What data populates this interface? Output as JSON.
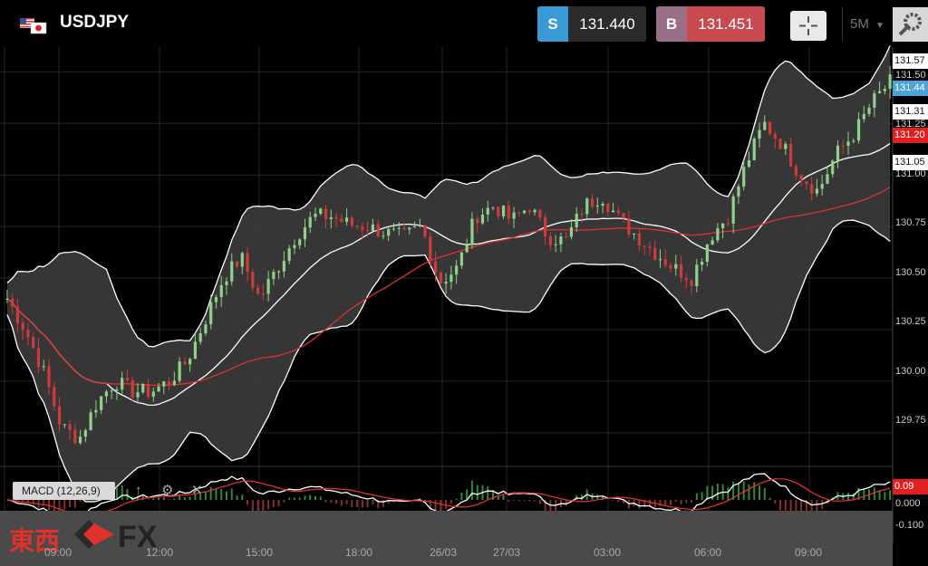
{
  "header": {
    "symbol": "USDJPY",
    "sell": {
      "label": "S",
      "price": "131.440"
    },
    "buy": {
      "label": "B",
      "price": "131.451"
    },
    "timeframe": "5M",
    "colors": {
      "sell": "#3a9ad6",
      "buy": "#c84a4f",
      "buy_tag": "#9a6e86"
    }
  },
  "macd": {
    "label": "MACD (12,26,9)",
    "value_badge": "0.09"
  },
  "watermark": {
    "text": "東西",
    "fx": "FX"
  },
  "price_badges": [
    {
      "text": "131.57",
      "style": "white"
    },
    {
      "text": "131.44",
      "style": "blue"
    },
    {
      "text": "131.31",
      "style": "white"
    },
    {
      "text": "131.20",
      "style": "red"
    },
    {
      "text": "131.05",
      "style": "white"
    }
  ],
  "chart_data": {
    "type": "candlestick",
    "y_axis_labels": [
      "131.50",
      "131.25",
      "131.00",
      "130.75",
      "130.50",
      "130.25",
      "130.00",
      "129.75"
    ],
    "x_axis_labels": [
      "09:00",
      "12:00",
      "15:00",
      "18:00",
      "26/03",
      "27/03",
      "03:00",
      "06:00",
      "09:00"
    ],
    "macd_axis_labels": [
      "0.000",
      "-0.100"
    ],
    "ylim": [
      129.6,
      131.62
    ],
    "series": [
      {
        "name": "Bollinger Bands",
        "color": "#ffffff"
      },
      {
        "name": "Moving Average",
        "color": "#e03030"
      }
    ],
    "close_path": [
      130.4,
      130.25,
      130.05,
      129.78,
      129.72,
      129.9,
      130.0,
      129.95,
      129.95,
      130.0,
      130.1,
      130.3,
      130.5,
      130.6,
      130.4,
      130.55,
      130.7,
      130.8,
      130.8,
      130.76,
      130.75,
      130.72,
      130.7,
      130.75,
      130.48,
      130.55,
      130.8,
      130.85,
      130.78,
      130.85,
      130.7,
      130.68,
      130.85,
      130.9,
      130.78,
      130.7,
      130.62,
      130.55,
      130.5,
      130.7,
      130.8,
      131.05,
      131.25,
      131.15,
      131.0,
      130.92,
      131.1,
      131.2,
      131.35,
      131.45
    ],
    "colors": {
      "up": "#8fd18a",
      "down": "#d13a3a",
      "band_fill": "#404040"
    }
  }
}
